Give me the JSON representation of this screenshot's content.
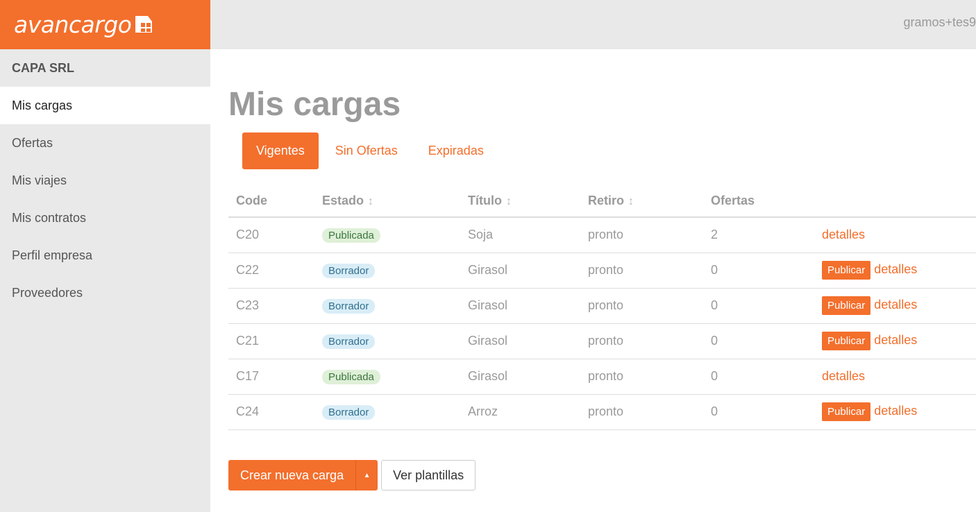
{
  "app": {
    "logo_text": "avancargo"
  },
  "header": {
    "user": "gramos+tes9"
  },
  "sidebar": {
    "company": "CAPA SRL",
    "items": [
      {
        "label": "Mis cargas",
        "active": true
      },
      {
        "label": "Ofertas"
      },
      {
        "label": "Mis viajes"
      },
      {
        "label": "Mis contratos"
      },
      {
        "label": "Perfil empresa"
      },
      {
        "label": "Proveedores"
      }
    ]
  },
  "main": {
    "title": "Mis cargas",
    "tabs": [
      {
        "label": "Vigentes",
        "active": true
      },
      {
        "label": "Sin Ofertas"
      },
      {
        "label": "Expiradas"
      }
    ],
    "table": {
      "headers": [
        "Code",
        "Estado",
        "Título",
        "Retiro",
        "Ofertas"
      ],
      "rows": [
        {
          "code": "C20",
          "estado": "Publicada",
          "titulo": "Soja",
          "retiro": "pronto",
          "ofertas": "2",
          "publicar": false
        },
        {
          "code": "C22",
          "estado": "Borrador",
          "titulo": "Girasol",
          "retiro": "pronto",
          "ofertas": "0",
          "publicar": true
        },
        {
          "code": "C23",
          "estado": "Borrador",
          "titulo": "Girasol",
          "retiro": "pronto",
          "ofertas": "0",
          "publicar": true
        },
        {
          "code": "C21",
          "estado": "Borrador",
          "titulo": "Girasol",
          "retiro": "pronto",
          "ofertas": "0",
          "publicar": true
        },
        {
          "code": "C17",
          "estado": "Publicada",
          "titulo": "Girasol",
          "retiro": "pronto",
          "ofertas": "0",
          "publicar": false
        },
        {
          "code": "C24",
          "estado": "Borrador",
          "titulo": "Arroz",
          "retiro": "pronto",
          "ofertas": "0",
          "publicar": true
        }
      ],
      "publicar_label": "Publicar",
      "detalles_label": "detalles"
    },
    "buttons": {
      "create": "Crear nueva carga",
      "templates": "Ver plantillas"
    }
  },
  "colors": {
    "accent": "#f36f2c",
    "published_bg": "#dff0d8",
    "draft_bg": "#d9edf7"
  }
}
